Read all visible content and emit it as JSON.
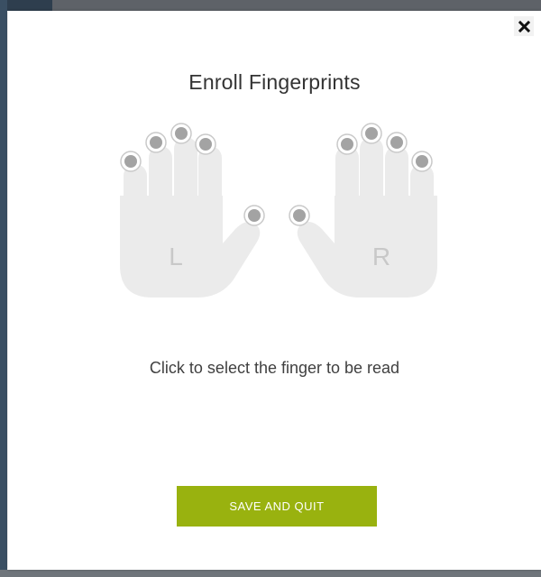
{
  "dialog": {
    "title": "Enroll Fingerprints",
    "close_icon": "close-icon",
    "instruction": "Click to select the finger to be read",
    "save_label": "SAVE AND QUIT"
  },
  "hands": {
    "left_label": "L",
    "right_label": "R",
    "finger_icon": "finger-dot-icon"
  },
  "colors": {
    "accent": "#99b20f",
    "hand_fill": "#ebebeb",
    "finger_dot": "#a3a3a3",
    "sidebar": "#3a4f63"
  }
}
